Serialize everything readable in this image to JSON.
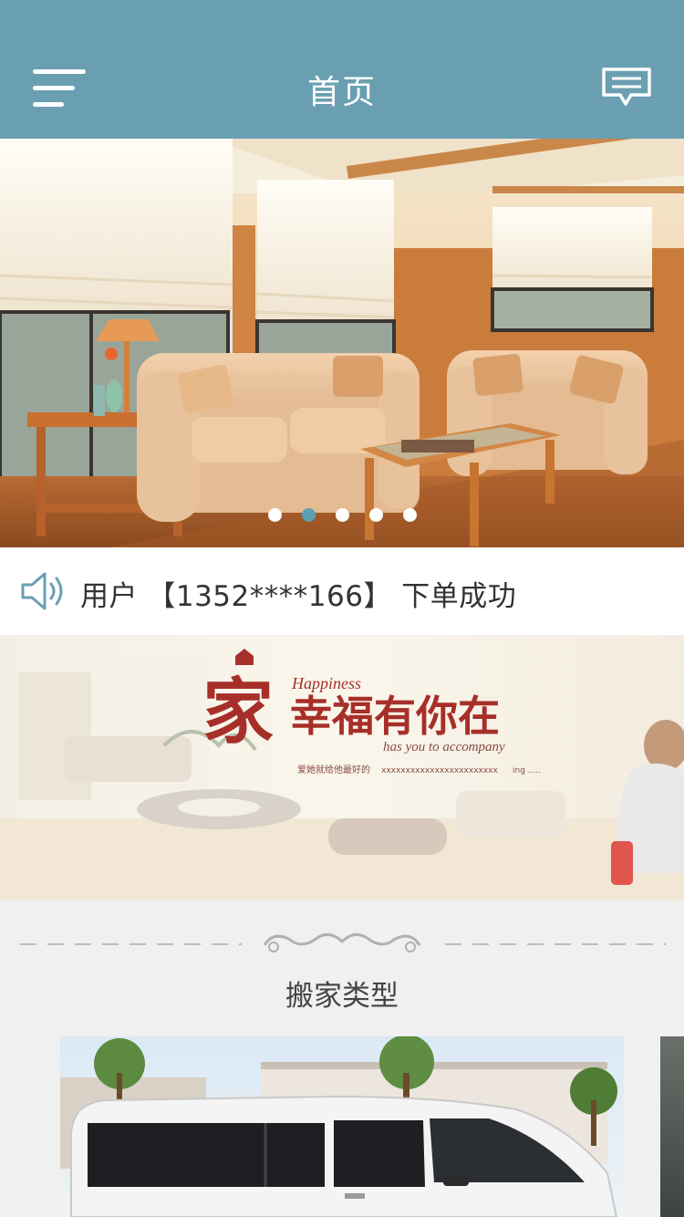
{
  "header": {
    "title": "首页",
    "bg_color": "#6a9fb2"
  },
  "carousel": {
    "slide_count": 5,
    "active_index": 1,
    "active_color": "#5a9fb2"
  },
  "notice": {
    "text": "用户 【1352****166】 下单成功"
  },
  "banner": {
    "main_char": "家",
    "headline": "幸福有你在",
    "script_en_1": "Happiness",
    "script_en_2": "has you to accompany",
    "small_text_1": "爱她就给他最好的",
    "small_text_2": "xxxxxxxxxxxxxxxxxxxxxxxx",
    "small_text_3": "ing ....."
  },
  "section": {
    "title": "搬家类型"
  },
  "cards": [
    {
      "name": "van-card"
    }
  ]
}
